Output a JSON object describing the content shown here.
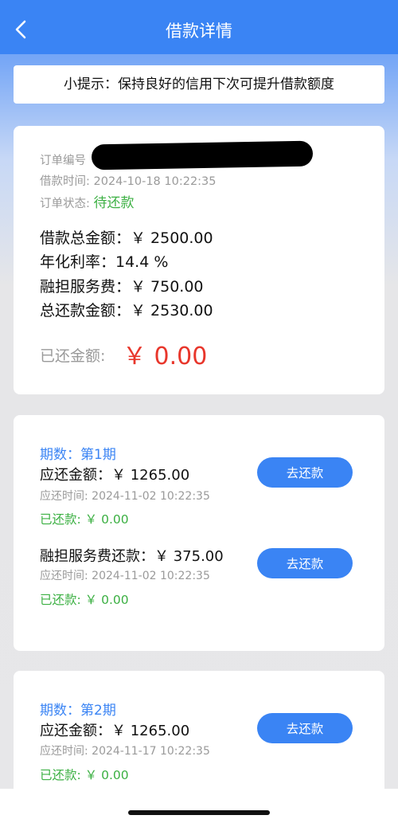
{
  "header": {
    "title": "借款详情"
  },
  "tip": {
    "text": "小提示：保持良好的信用下次可提升借款额度"
  },
  "order": {
    "number_label": "订单编号",
    "time_label": "借款时间:",
    "time_value": "2024-10-18 10:22:35",
    "status_label": "订单状态:",
    "status_value": "待还款",
    "total_line": "借款总金额：￥ 2500.00",
    "rate_line": "年化利率：14.4 %",
    "fee_line": "融担服务费：￥ 750.00",
    "repay_total_line": "总还款金额：￥ 2530.00",
    "paid_label": "已还金额:",
    "paid_value": "￥ 0.00"
  },
  "installments": [
    {
      "period": "期数：第1期",
      "amount": "应还金额：￥ 1265.00",
      "due": "应还时间: 2024-11-02 10:22:35",
      "paid": "已还款: ￥ 0.00",
      "button": "去还款",
      "fee": {
        "amount": "融担服务费还款：￥ 375.00",
        "due": "应还时间: 2024-11-02 10:22:35",
        "paid": "已还款: ￥ 0.00",
        "button": "去还款"
      }
    },
    {
      "period": "期数：第2期",
      "amount": "应还金额：￥ 1265.00",
      "due": "应还时间: 2024-11-17 10:22:35",
      "paid": "已还款: ￥ 0.00",
      "button": "去还款"
    }
  ],
  "colors": {
    "accent": "#3a84f4",
    "status_green": "#3cb043",
    "paid_red": "#e8362b"
  }
}
